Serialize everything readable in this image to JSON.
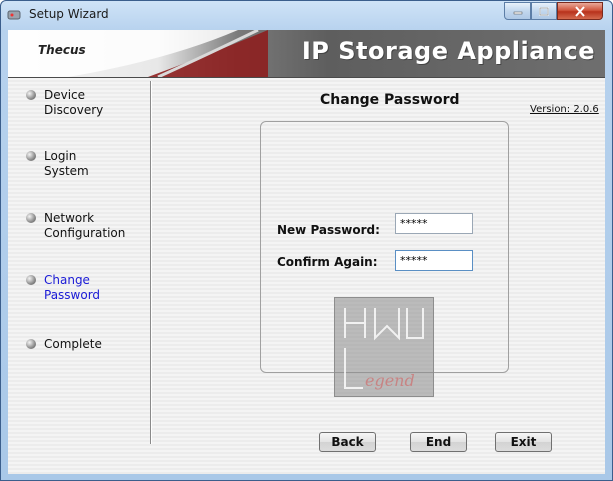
{
  "window": {
    "title": "Setup Wizard"
  },
  "banner": {
    "logo": "Thecus",
    "title": "IP Storage Appliance"
  },
  "steps": [
    {
      "line1": "Device",
      "line2": "Discovery",
      "active": false
    },
    {
      "line1": "Login",
      "line2": "System",
      "active": false
    },
    {
      "line1": "Network",
      "line2": "Configuration",
      "active": false
    },
    {
      "line1": "Change",
      "line2": "Password",
      "active": true
    },
    {
      "line1": "Complete",
      "line2": "",
      "active": false
    }
  ],
  "page": {
    "title": "Change Password",
    "version": "Version: 2.0.6"
  },
  "form": {
    "new_password_label": "New Password:",
    "new_password_value": "*****",
    "confirm_label": "Confirm Again:",
    "confirm_value": "*****"
  },
  "watermark": {
    "text": "XW Legend"
  },
  "buttons": {
    "back": "Back",
    "end": "End",
    "exit": "Exit"
  },
  "colors": {
    "active_step": "#1a1ad6",
    "title_bar": "#b7d2ee",
    "close": "#c4452b"
  }
}
